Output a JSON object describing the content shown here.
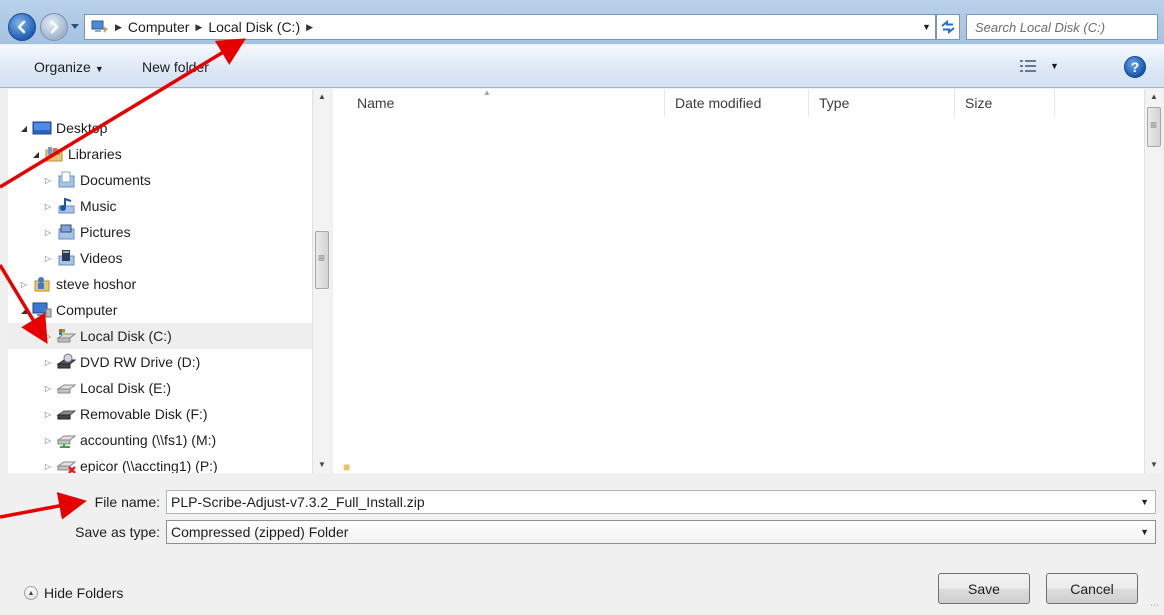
{
  "address_bar": {
    "breadcrumbs": [
      "Computer",
      "Local Disk (C:)"
    ],
    "search_placeholder": "Search Local Disk (C:)"
  },
  "toolbar": {
    "organize_label": "Organize",
    "new_folder_label": "New folder",
    "help_label": "?"
  },
  "nav_tree": {
    "items": [
      {
        "label": "Desktop",
        "icon": "desktop-icon",
        "expanded": true
      },
      {
        "label": "Libraries",
        "icon": "libraries-icon",
        "expanded": true
      },
      {
        "label": "Documents",
        "icon": "documents-icon",
        "expanded": false
      },
      {
        "label": "Music",
        "icon": "music-icon",
        "expanded": false
      },
      {
        "label": "Pictures",
        "icon": "pictures-icon",
        "expanded": false
      },
      {
        "label": "Videos",
        "icon": "videos-icon",
        "expanded": false
      },
      {
        "label": "steve hoshor",
        "icon": "user-folder-icon",
        "expanded": false
      },
      {
        "label": "Computer",
        "icon": "computer-icon",
        "expanded": true
      },
      {
        "label": "Local Disk (C:)",
        "icon": "system-drive-icon",
        "expanded": false,
        "selected": true
      },
      {
        "label": "DVD RW Drive (D:)",
        "icon": "dvd-drive-icon",
        "expanded": false
      },
      {
        "label": "Local Disk (E:)",
        "icon": "hard-drive-icon",
        "expanded": false
      },
      {
        "label": "Removable Disk (F:)",
        "icon": "removable-drive-icon",
        "expanded": false
      },
      {
        "label": "accounting (\\\\fs1) (M:)",
        "icon": "network-drive-icon",
        "expanded": false
      },
      {
        "label": "epicor (\\\\accting1) (P:)",
        "icon": "disconnected-network-drive-icon",
        "expanded": false
      }
    ]
  },
  "file_list": {
    "columns": [
      "Name",
      "Date modified",
      "Type",
      "Size"
    ]
  },
  "form": {
    "file_name_label": "File name:",
    "file_name_value": "PLP-Scribe-Adjust-v7.3.2_Full_Install.zip",
    "save_type_label": "Save as type:",
    "save_type_value": "Compressed (zipped) Folder"
  },
  "footer": {
    "hide_folders_label": "Hide Folders",
    "save_label": "Save",
    "cancel_label": "Cancel"
  },
  "colors": {
    "annotation_arrow": "#e60000",
    "address_bar_bg": "#b9d1ea",
    "selected_row_bg": "#eeeeee"
  }
}
